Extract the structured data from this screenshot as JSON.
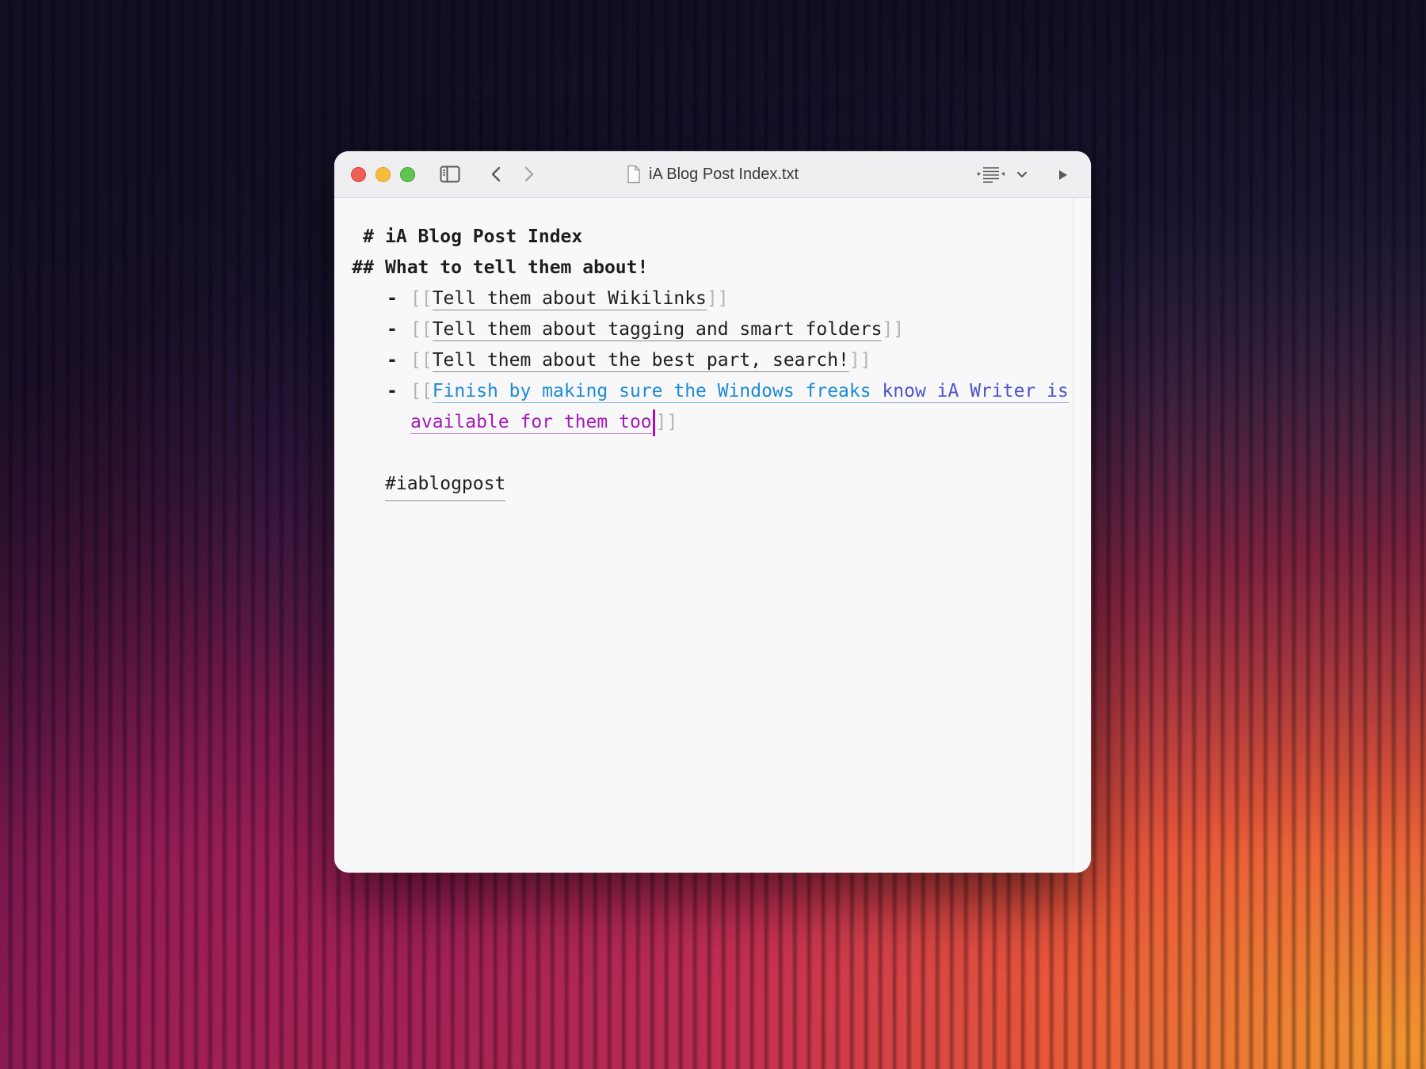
{
  "window": {
    "title": "iA Blog Post Index.txt",
    "icons": [
      "sidebar-icon",
      "back-chevron-icon",
      "forward-chevron-icon",
      "document-icon",
      "outline-icon",
      "chevron-down-icon",
      "play-icon"
    ]
  },
  "colors": {
    "link_blue": "#1c8bd4",
    "link_indigo": "#4a55c9",
    "link_magenta": "#a21cb5",
    "caret": "#b30bb3"
  },
  "editor": {
    "h1": {
      "marker": "#",
      "text": "iA Blog Post Index"
    },
    "h2": {
      "marker": "##",
      "text": "What to tell them about!"
    },
    "list": [
      {
        "marker": "-",
        "open": "[[",
        "text": "Tell them about Wikilinks",
        "close": "]]"
      },
      {
        "marker": "-",
        "open": "[[",
        "text": "Tell them about tagging and smart folders",
        "close": "]]"
      },
      {
        "marker": "-",
        "open": "[[",
        "text": "Tell them about the best part, search!",
        "close": "]]"
      },
      {
        "marker": "-",
        "open": "[[",
        "text_a": "Finish by making sure the Windows freaks ",
        "text_b": "know iA Writer is",
        "text_c": "available for them too",
        "close": "]]"
      }
    ],
    "tag": "#iablogpost"
  }
}
